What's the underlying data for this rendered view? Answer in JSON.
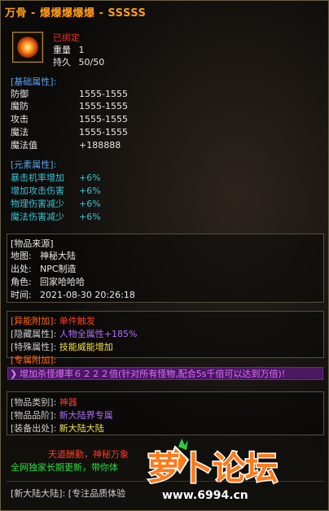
{
  "title": "万骨 - 爆爆爆爆爆 - SSSSS",
  "bound": "已绑定",
  "weight_label": "重量",
  "weight_value": "1",
  "durability_label": "持久",
  "durability_value": "50/50",
  "base_header": "[基础属性]:",
  "base_stats": [
    {
      "k": "防御",
      "v": "1555-1555"
    },
    {
      "k": "魔防",
      "v": "1555-1555"
    },
    {
      "k": "攻击",
      "v": "1555-1555"
    },
    {
      "k": "魔法",
      "v": "1555-1555"
    },
    {
      "k": "魔法值",
      "v": "+188888"
    }
  ],
  "element_header": "[元素属性]:",
  "element_stats": [
    {
      "k": "暴击机率增加",
      "v": "+6%"
    },
    {
      "k": "增加攻击伤害",
      "v": "+6%"
    },
    {
      "k": "物理伤害减少",
      "v": "+6%"
    },
    {
      "k": "魔法伤害减少",
      "v": "+6%"
    }
  ],
  "source_header": "[物品来源]",
  "source": [
    {
      "k": "地图:",
      "v": "神秘大陆"
    },
    {
      "k": "出处:",
      "v": "NPC制造"
    },
    {
      "k": "角色:",
      "v": "回家哈哈哈"
    },
    {
      "k": "时间:",
      "v": "2021-08-30 20:26:18"
    }
  ],
  "special": {
    "abnormal_label": "[异能附加]:",
    "abnormal_value": "单件触发",
    "hidden_label": "[隐藏属性]:",
    "hidden_value": "人物全属性+185%",
    "special_label": "[特殊属性]:",
    "special_value": "技能威能增加",
    "exclusive_label": "[专属附加]:",
    "exclusive_line": "增加杀怪爆率６２２２倍(针对所有怪物,配合5s千倍可以达到万倍)!"
  },
  "category": {
    "type_label": "[物品类别]:",
    "type_value": "神器",
    "quality_label": "[物品品阶]:",
    "quality_value": "新大陆界专属",
    "origin_label": "[装备出处]:",
    "origin_value": "新大陆大陆"
  },
  "footer": {
    "line1": "天道酬勤，神秘万象",
    "line2": "全网独家长期更新，带你体",
    "bottom_label": "[新大陆大陆]:",
    "bottom_value": "[专注品质体验"
  },
  "watermark": {
    "logo_text": "萝卜论坛",
    "url": "www.6994.cn"
  },
  "colors": {
    "title": "#ff9a1a",
    "header": "#5aa5f0",
    "element": "#38c4d8",
    "exclusive_bg": "#4a1763"
  }
}
